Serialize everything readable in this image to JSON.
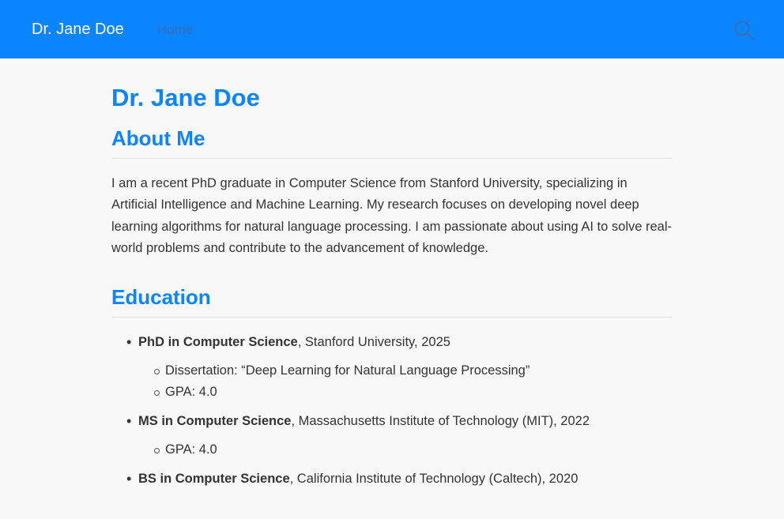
{
  "navbar": {
    "brand": "Dr. Jane Doe",
    "home_link": "Home",
    "search_icon": "search-icon",
    "background_color": "#0a84ff"
  },
  "page": {
    "title": "Dr. Jane Doe"
  },
  "about": {
    "heading": "About Me",
    "text": "I am a recent PhD graduate in Computer Science from Stanford University, specializing in Artificial Intelligence and Machine Learning. My research focuses on developing novel deep learning algorithms for natural language processing. I am passionate about using AI to solve real-world problems and contribute to the advancement of knowledge."
  },
  "education": {
    "heading": "Education",
    "items": [
      {
        "degree": "PhD in Computer Science",
        "detail": ", Stanford University, 2025",
        "sub": [
          "Dissertation: “Deep Learning for Natural Language Processing”",
          "GPA: 4.0"
        ]
      },
      {
        "degree": "MS in Computer Science",
        "detail": ", Massachusetts Institute of Technology (MIT), 2022",
        "sub": [
          "GPA: 4.0"
        ]
      },
      {
        "degree": "BS in Computer Science",
        "detail": ", California Institute of Technology (Caltech), 2020",
        "sub": []
      }
    ]
  },
  "colors": {
    "accent": "#0a84ff",
    "background": "#f8f8f8",
    "text": "#333333"
  }
}
